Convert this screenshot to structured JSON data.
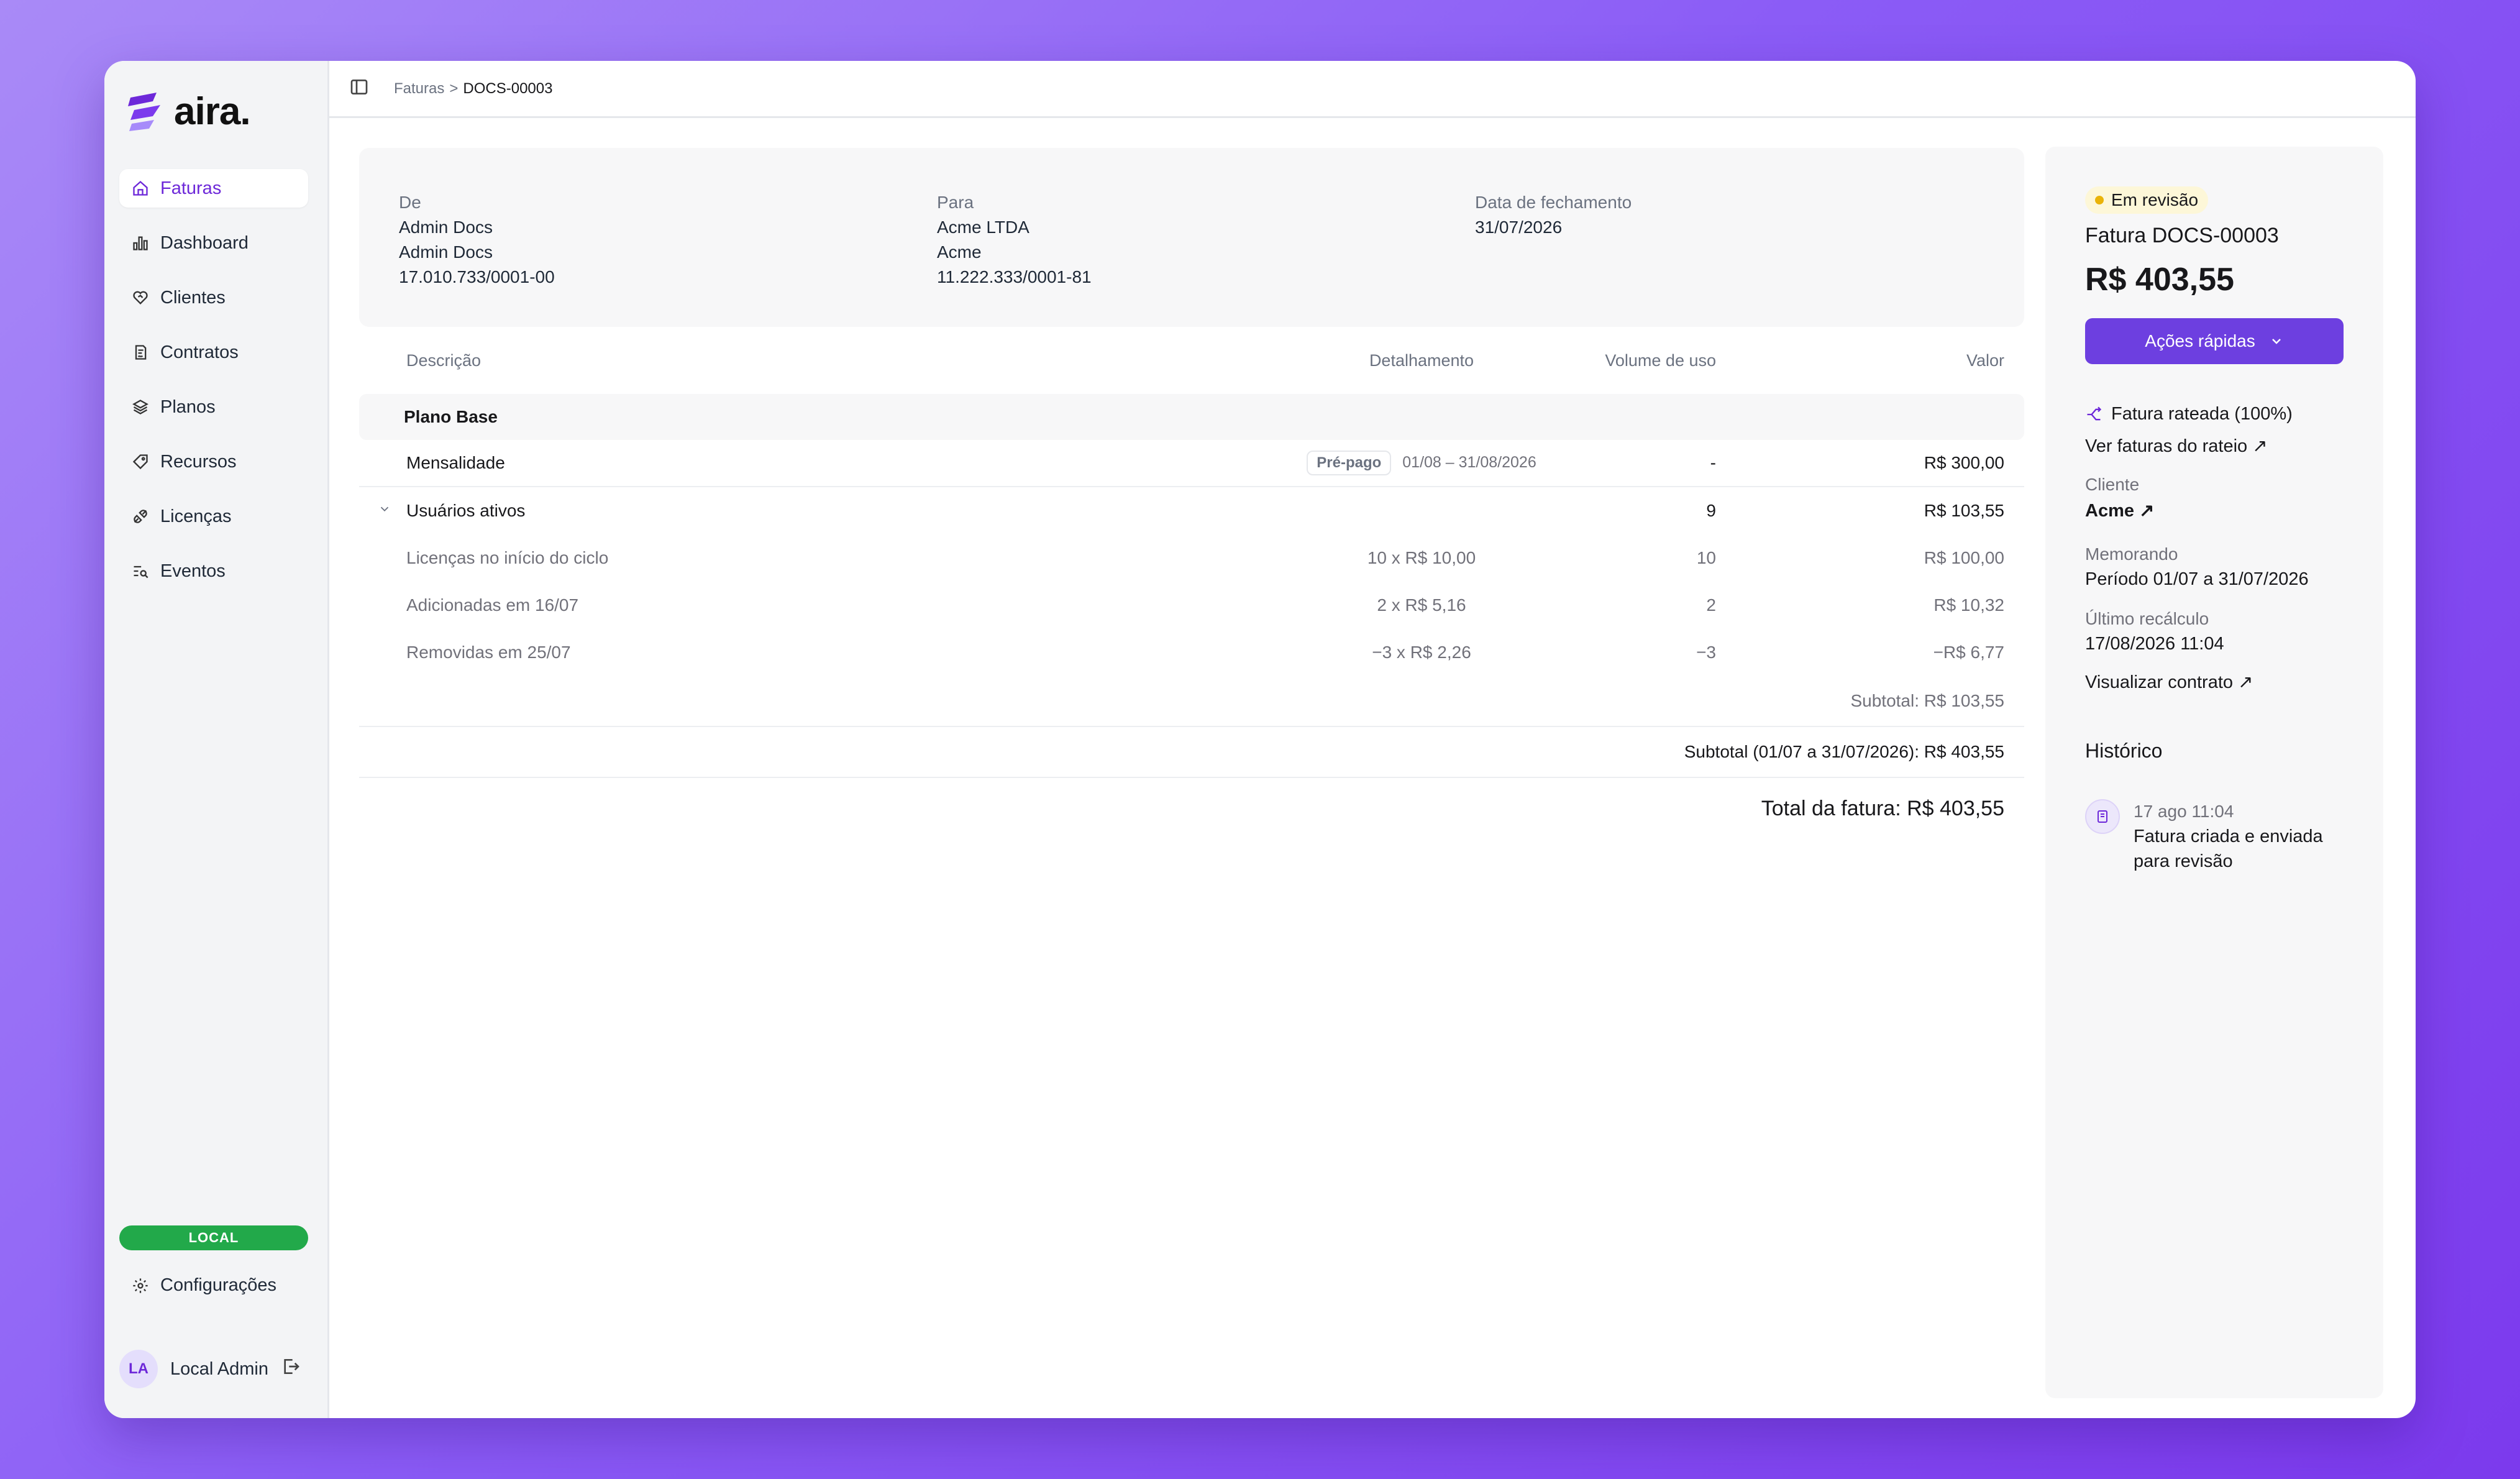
{
  "app": {
    "name": "aira."
  },
  "sidebar": {
    "items": [
      {
        "label": "Faturas",
        "icon": "home-icon"
      },
      {
        "label": "Dashboard",
        "icon": "chart-bar-icon"
      },
      {
        "label": "Clientes",
        "icon": "heart-handshake-icon"
      },
      {
        "label": "Contratos",
        "icon": "contract-icon"
      },
      {
        "label": "Planos",
        "icon": "layers-icon"
      },
      {
        "label": "Recursos",
        "icon": "tag-icon"
      },
      {
        "label": "Licenças",
        "icon": "plug-icon"
      },
      {
        "label": "Eventos",
        "icon": "list-search-icon"
      }
    ],
    "env_badge": "LOCAL",
    "settings_label": "Configurações",
    "user": {
      "initials": "LA",
      "name": "Local Admin"
    }
  },
  "breadcrumb": {
    "parent": "Faturas",
    "separator": ">",
    "current": "DOCS-00003"
  },
  "invoice_header": {
    "from": {
      "label": "De",
      "lines": [
        "Admin Docs",
        "Admin Docs",
        "17.010.733/0001-00"
      ]
    },
    "to": {
      "label": "Para",
      "lines": [
        "Acme LTDA",
        "Acme",
        "11.222.333/0001-81"
      ]
    },
    "closing": {
      "label": "Data de fechamento",
      "value": "31/07/2026"
    }
  },
  "table": {
    "headers": {
      "description": "Descrição",
      "detail": "Detalhamento",
      "usage": "Volume de uso",
      "value": "Valor"
    },
    "group": "Plano Base",
    "rows": {
      "mensalidade": {
        "description": "Mensalidade",
        "pill": "Pré-pago",
        "period": "01/08 – 31/08/2026",
        "usage": "-",
        "value": "R$ 300,00"
      },
      "usuarios": {
        "description": "Usuários ativos",
        "usage": "9",
        "value": "R$ 103,55"
      },
      "sub1": {
        "description": "Licenças no início do ciclo",
        "detail": "10 x R$ 10,00",
        "usage": "10",
        "value": "R$ 100,00"
      },
      "sub2": {
        "description": "Adicionadas em 16/07",
        "detail": "2 x R$ 5,16",
        "usage": "2",
        "value": "R$ 10,32"
      },
      "sub3": {
        "description": "Removidas em 25/07",
        "detail": "−3 x R$ 2,26",
        "usage": "−3",
        "value": "−R$ 6,77"
      }
    },
    "subtotal_group": "Subtotal: R$ 103,55",
    "subtotal_period": "Subtotal (01/07 a 31/07/2026): R$ 403,55",
    "total": "Total da fatura: R$ 403,55"
  },
  "panel": {
    "status": "Em revisão",
    "title": "Fatura DOCS-00003",
    "amount": "R$ 403,55",
    "quick_actions": "Ações rápidas",
    "prorated": "Fatura rateada (100%)",
    "prorated_link": "Ver faturas do rateio",
    "client_label": "Cliente",
    "client_link": "Acme",
    "memo_label": "Memorando",
    "memo_value": "Período 01/07 a 31/07/2026",
    "recalc_label": "Último recálculo",
    "recalc_value": "17/08/2026 11:04",
    "contract_link": "Visualizar contrato",
    "history_title": "Histórico",
    "history": [
      {
        "time": "17 ago 11:04",
        "text_line1": "Fatura criada e enviada",
        "text_line2": "para revisão"
      }
    ]
  },
  "colors": {
    "accent": "#6d3fe0",
    "status_dot": "#eab308",
    "env_badge": "#22a94a"
  }
}
